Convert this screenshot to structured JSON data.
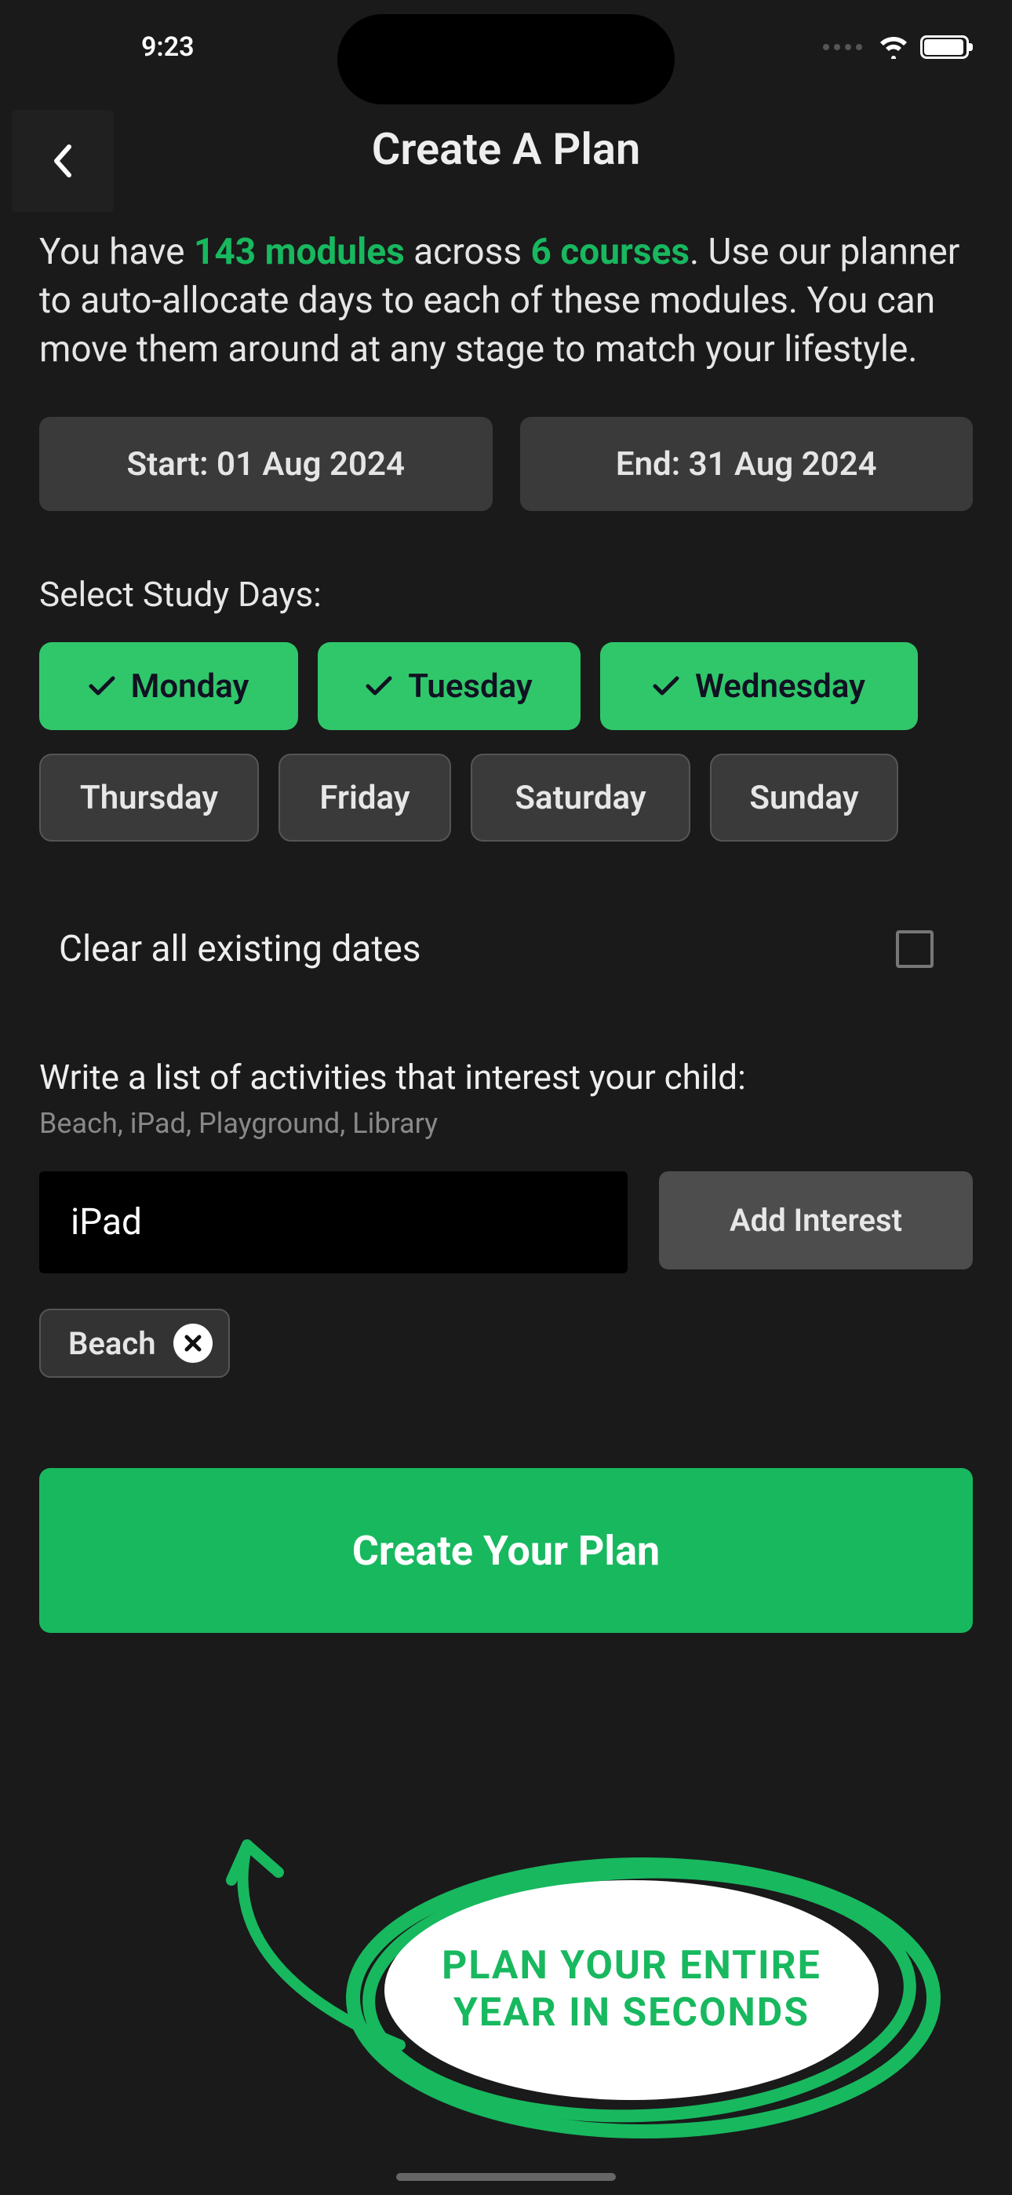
{
  "status": {
    "time": "9:23"
  },
  "header": {
    "title": "Create A Plan"
  },
  "intro": {
    "prefix": "You have ",
    "modules_count": "143 modules",
    "mid1": " across ",
    "courses_count": "6 courses",
    "suffix": ". Use our planner to auto-allocate days to each of these modules. You can move them around at any stage to match your lifestyle."
  },
  "dates": {
    "start_label": "Start: 01 Aug 2024",
    "end_label": "End: 31 Aug 2024"
  },
  "study_days": {
    "label": "Select Study Days:",
    "days": [
      {
        "name": "Monday",
        "selected": true
      },
      {
        "name": "Tuesday",
        "selected": true
      },
      {
        "name": "Wednesday",
        "selected": true
      },
      {
        "name": "Thursday",
        "selected": false
      },
      {
        "name": "Friday",
        "selected": false
      },
      {
        "name": "Saturday",
        "selected": false
      },
      {
        "name": "Sunday",
        "selected": false
      }
    ]
  },
  "clear_dates": {
    "label": "Clear all existing dates",
    "checked": false
  },
  "activities": {
    "label": "Write a list of activities that interest your child:",
    "hint": "Beach, iPad, Playground, Library",
    "input_value": "iPad",
    "add_button": "Add Interest",
    "chips": [
      {
        "label": "Beach"
      }
    ]
  },
  "cta": {
    "label": "Create Your Plan"
  },
  "annotation": {
    "text": "PLAN YOUR ENTIRE YEAR IN SECONDS"
  },
  "colors": {
    "accent": "#18b85f",
    "accent_bright": "#30c76b",
    "bg": "#1a1a1a",
    "surface": "#3a3a3a"
  }
}
